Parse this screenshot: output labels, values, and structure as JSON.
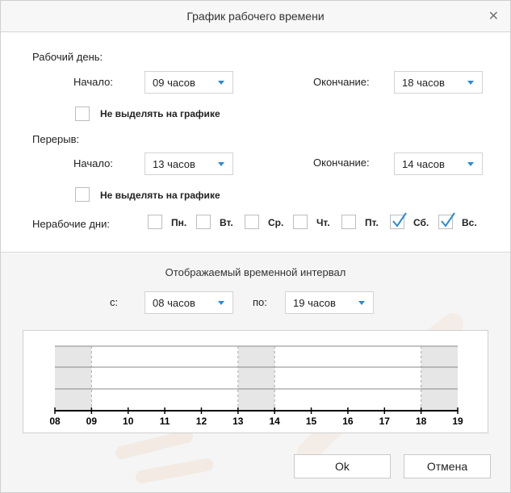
{
  "dialog": {
    "title": "График рабочего времени"
  },
  "work_day": {
    "label": "Рабочий день:",
    "start_label": "Начало:",
    "start_value": "09 часов",
    "end_label": "Окончание:",
    "end_value": "18 часов",
    "hide_label": "Не выделять на графике",
    "hide_checked": false
  },
  "break": {
    "label": "Перерыв:",
    "start_label": "Начало:",
    "start_value": "13 часов",
    "end_label": "Окончание:",
    "end_value": "14 часов",
    "hide_label": "Не выделять на графике",
    "hide_checked": false
  },
  "non_working": {
    "label": "Нерабочие дни:",
    "days": [
      {
        "label": "Пн.",
        "checked": false
      },
      {
        "label": "Вт.",
        "checked": false
      },
      {
        "label": "Ср.",
        "checked": false
      },
      {
        "label": "Чт.",
        "checked": false
      },
      {
        "label": "Пт.",
        "checked": false
      },
      {
        "label": "Сб.",
        "checked": true
      },
      {
        "label": "Вс.",
        "checked": true
      }
    ]
  },
  "interval": {
    "title": "Отображаемый временной интервал",
    "from_label": "с:",
    "from_value": "08 часов",
    "to_label": "по:",
    "to_value": "19 часов"
  },
  "timeline": {
    "hours": [
      "08",
      "09",
      "10",
      "11",
      "12",
      "13",
      "14",
      "15",
      "16",
      "17",
      "18",
      "19"
    ],
    "range": [
      8,
      19
    ],
    "shaded": [
      [
        8,
        9
      ],
      [
        13,
        14
      ],
      [
        18,
        19
      ]
    ],
    "shade_color": "#e6e6e6",
    "accent_color": "#2a8ad6"
  },
  "buttons": {
    "ok": "Ok",
    "cancel": "Отмена"
  }
}
